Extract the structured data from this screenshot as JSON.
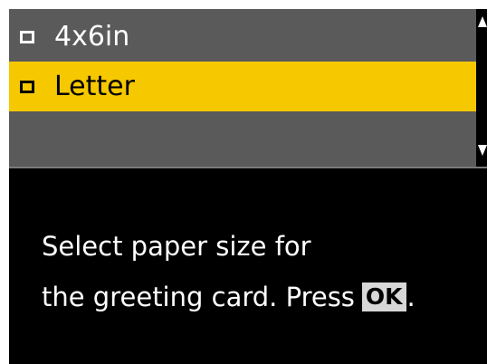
{
  "menu": {
    "items": [
      {
        "label": "4x6in",
        "selected": false
      },
      {
        "label": "Letter",
        "selected": true
      }
    ],
    "highlight_color": "#f6c800"
  },
  "scrollbar": {
    "up_icon": "triangle-up",
    "down_icon": "triangle-down"
  },
  "message": {
    "line1": "Select paper size for",
    "line2": "the greeting card. Press",
    "button_label": "OK",
    "end": "."
  }
}
